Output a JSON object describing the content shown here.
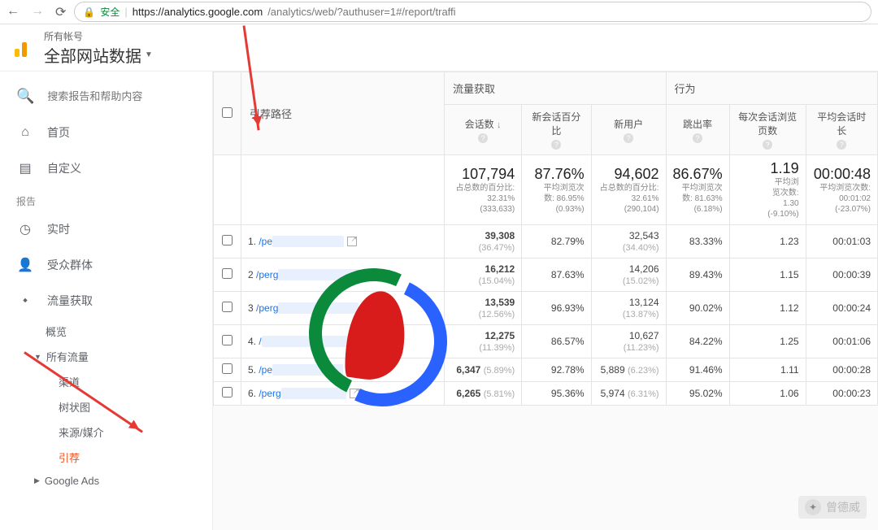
{
  "browser": {
    "secure_label": "安全",
    "url_host": "https://analytics.google.com",
    "url_path": "/analytics/web/?authuser=1#/report/traffi"
  },
  "header": {
    "all_accounts": "所有帐号",
    "title": "全部网站数据"
  },
  "sidebar": {
    "search_placeholder": "搜索报告和帮助内容",
    "home": "首页",
    "custom": "自定义",
    "reports_label": "报告",
    "realtime": "实时",
    "audience": "受众群体",
    "acquisition": "流量获取",
    "overview": "概览",
    "all_traffic": "所有流量",
    "channels": "渠道",
    "treemap": "树状图",
    "source_medium": "来源/媒介",
    "referrals": "引荐",
    "google_ads": "Google Ads"
  },
  "table": {
    "group_acq": "流量获取",
    "group_behavior": "行为",
    "col_path": "引荐路径",
    "col_sessions": "会话数",
    "col_new_pct": "新会话百分比",
    "col_new_users": "新用户",
    "col_bounce": "跳出率",
    "col_pages": "每次会话浏览页数",
    "col_duration": "平均会话时长",
    "summary": {
      "sessions": {
        "v": "107,794",
        "n1": "占总数的百分比:",
        "n2": "32.31% (333,633)"
      },
      "new_pct": {
        "v": "87.76%",
        "n1": "平均浏览次",
        "n2": "数: 86.95%",
        "n3": "(0.93%)"
      },
      "new_users": {
        "v": "94,602",
        "n1": "占总数的百分比:",
        "n2": "32.61% (290,104)"
      },
      "bounce": {
        "v": "86.67%",
        "n1": "平均浏览次",
        "n2": "数: 81.63%",
        "n3": "(6.18%)"
      },
      "pages": {
        "v": "1.19",
        "n1": "平均浏",
        "n2": "览次数:",
        "n3": "1.30",
        "n4": "(-9.10%)"
      },
      "duration": {
        "v": "00:00:48",
        "n1": "平均浏览次数:",
        "n2": "00:01:02",
        "n3": "(-23.07%)"
      }
    },
    "rows": [
      {
        "i": "1.",
        "p": "/pe",
        "s": "39,308",
        "sp": "(36.47%)",
        "np": "82.79%",
        "nu": "32,543",
        "nup": "(34.40%)",
        "b": "83.33%",
        "pg": "1.23",
        "d": "00:01:03"
      },
      {
        "i": "2",
        "p": "/perg",
        "s": "16,212",
        "sp": "(15.04%)",
        "np": "87.63%",
        "nu": "14,206",
        "nup": "(15.02%)",
        "b": "89.43%",
        "pg": "1.15",
        "d": "00:00:39"
      },
      {
        "i": "3",
        "p": "/perg",
        "s": "13,539",
        "sp": "(12.56%)",
        "np": "96.93%",
        "nu": "13,124",
        "nup": "(13.87%)",
        "b": "90.02%",
        "pg": "1.12",
        "d": "00:00:24"
      },
      {
        "i": "4.",
        "p": "/",
        "s": "12,275",
        "sp": "(11.39%)",
        "np": "86.57%",
        "nu": "10,627",
        "nup": "(11.23%)",
        "b": "84.22%",
        "pg": "1.25",
        "d": "00:01:06"
      },
      {
        "i": "5.",
        "p": "/pe",
        "s": "6,347",
        "sp": "(5.89%)",
        "np": "92.78%",
        "nu": "5,889",
        "nup": "(6.23%)",
        "b": "91.46%",
        "pg": "1.11",
        "d": "00:00:28"
      },
      {
        "i": "6.",
        "p": "/perg",
        "s": "6,265",
        "sp": "(5.81%)",
        "np": "95.36%",
        "nu": "5,974",
        "nup": "(6.31%)",
        "b": "95.02%",
        "pg": "1.06",
        "d": "00:00:23"
      }
    ]
  },
  "watermark": {
    "text": "曾德威"
  }
}
